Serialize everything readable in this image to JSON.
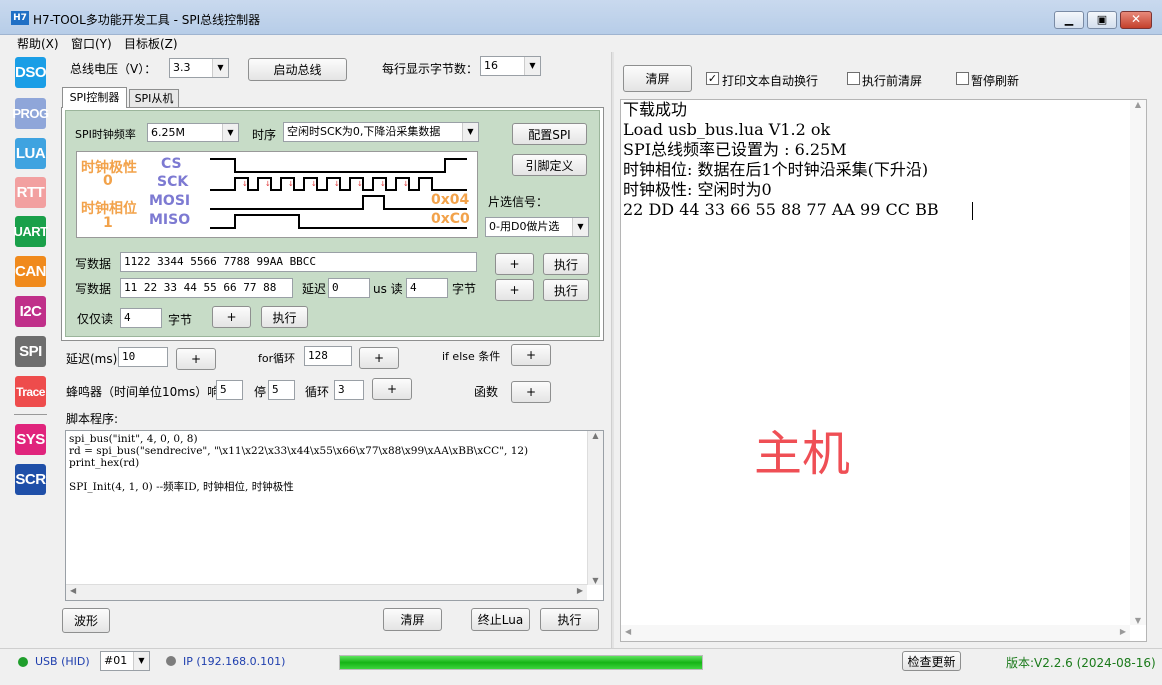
{
  "window": {
    "title": "H7-TOOL多功能开发工具 - SPI总线控制器",
    "logo": "H7"
  },
  "menu": [
    "帮助(X)",
    "窗口(Y)",
    "目标板(Z)"
  ],
  "sidebar": [
    {
      "label": "DSO",
      "color": "#1a9ee6"
    },
    {
      "label": "PROG",
      "color": "#8fa6d9"
    },
    {
      "label": "LUA",
      "color": "#3fa3e0"
    },
    {
      "label": "RTT",
      "color": "#f2a0a0"
    },
    {
      "label": "UART",
      "color": "#1aa04a"
    },
    {
      "label": "CAN",
      "color": "#f08a1c"
    },
    {
      "label": "I2C",
      "color": "#c0308a"
    },
    {
      "label": "SPI",
      "color": "#6e6e6e"
    },
    {
      "label": "Trace",
      "color": "#ee4c4c"
    },
    {
      "label": "SYS",
      "color": "#e0247c"
    },
    {
      "label": "SCR",
      "color": "#1f4fa8"
    }
  ],
  "top": {
    "voltage_label": "总线电压（V）：",
    "voltage_value": "3.3",
    "start_bus": "启动总线",
    "bytes_per_line_label": "每行显示字节数：",
    "bytes_per_line_value": "16"
  },
  "tabs": [
    "SPI控制器",
    "SPI从机"
  ],
  "spi": {
    "freq_label": "SPI时钟频率",
    "freq_value": "6.25M",
    "timing_label": "时序",
    "timing_value": "空闲时SCK为0,下降沿采集数据",
    "config_btn": "配置SPI",
    "pin_btn": "引脚定义",
    "cs_label": "片选信号：",
    "cs_value": "0-用D0做片选"
  },
  "diagram": {
    "cpol_label": "时钟极性",
    "cpol_value": "0",
    "cpha_label": "时钟相位",
    "cpha_value": "1",
    "cs": "CS",
    "sck": "SCK",
    "mosi": "MOSI",
    "miso": "MISO",
    "mosi_value": "0x04",
    "miso_value": "0xC0"
  },
  "write1": {
    "label": "写数据",
    "value": "1122 3344 5566 7788 99AA BBCC",
    "plus": "+",
    "exec": "执行"
  },
  "write2": {
    "label": "写数据",
    "value": "11 22 33 44 55 66 77 88",
    "delay_label": "延迟",
    "delay_value": "0",
    "us_read": "us 读",
    "read_value": "4",
    "bytes": "字节",
    "plus": "+",
    "exec": "执行"
  },
  "readonly": {
    "label": "仅仅读",
    "value": "4",
    "bytes": "字节",
    "plus": "+",
    "exec": "执行"
  },
  "script_ops": {
    "delay_label": "延迟(ms)",
    "delay_value": "10",
    "for_label": "for循环",
    "for_value": "128",
    "ifelse_label": "if else 条件",
    "beep_label": "蜂鸣器（时间单位10ms）响",
    "beep_on": "5",
    "beep_off_label": "停",
    "beep_off": "5",
    "beep_loop_label": "循环",
    "beep_loop": "3",
    "func_label": "函数",
    "plus": "+"
  },
  "script": {
    "label": "脚本程序:",
    "lines": [
      "spi_bus(\"init\", 4, 0, 0, 8)",
      "rd = spi_bus(\"sendrecive\", \"\\x11\\x22\\x33\\x44\\x55\\x66\\x77\\x88\\x99\\xAA\\xBB\\xCC\", 12)",
      "print_hex(rd)",
      "",
      "SPI_Init(4, 1, 0) --频率ID, 时钟相位, 时钟极性"
    ]
  },
  "bottom_buttons": {
    "wave": "波形",
    "clear": "清屏",
    "stop": "终止Lua",
    "exec": "执行"
  },
  "output": {
    "clear_btn": "清屏",
    "wrap_label": "打印文本自动换行",
    "wrap_checked": true,
    "pre_clear_label": "执行前清屏",
    "pre_clear_checked": false,
    "pause_label": "暂停刷新",
    "pause_checked": false,
    "lines": [
      "下载成功",
      "Load usb_bus.lua V1.2 ok",
      "SPI总线频率已设置为 : 6.25M",
      "时钟相位: 数据在后1个时钟沿采集(下升沿)",
      "时钟极性: 空闲时为0",
      "22 DD 44 33 66 55 88 77 AA 99 CC BB"
    ],
    "overlay": "主机"
  },
  "status": {
    "usb": "USB (HID)",
    "port": "#01",
    "ip": "IP (192.168.0.101)",
    "progress": 1.0,
    "check_update": "检查更新",
    "version": "版本:V2.2.6 (2024-08-16)"
  }
}
